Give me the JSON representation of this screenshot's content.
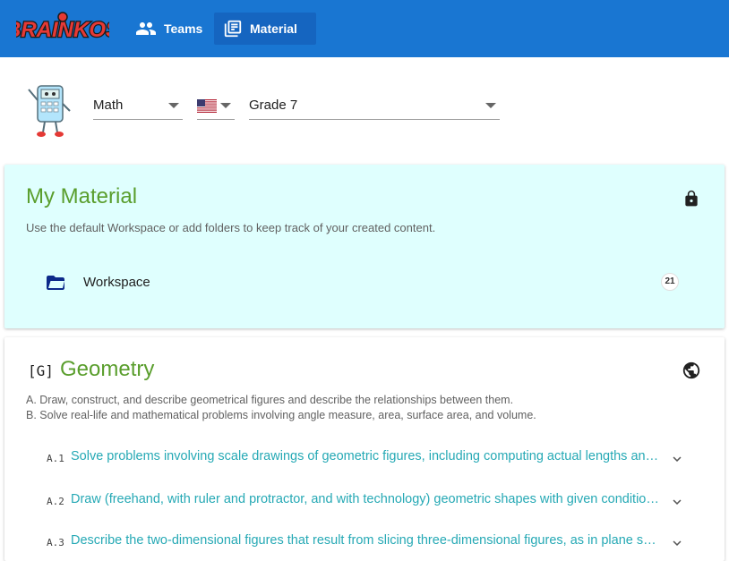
{
  "app": {
    "logo_text": "BRAINKOS",
    "nav": [
      {
        "label": "Teams",
        "icon": "people-icon"
      },
      {
        "label": "Material",
        "icon": "library-books-icon",
        "active": true
      }
    ],
    "colors": {
      "topbar": "#1976d2",
      "active_tab": "#1565c0",
      "title_green": "#5a9e2d",
      "link_teal": "#26a9b5"
    }
  },
  "selectors": {
    "subject": "Math",
    "language_flag": "us-flag-icon",
    "grade": "Grade 7"
  },
  "my_material": {
    "title": "My Material",
    "description": "Use the default Workspace or add folders to keep track of your created content.",
    "folder": {
      "label": "Workspace",
      "count": "21"
    }
  },
  "geometry": {
    "code": "[G]",
    "title": "Geometry",
    "description_lines": [
      "A. Draw, construct, and describe geometrical figures and describe the relationships between them.",
      "B. Solve real-life and mathematical problems involving angle measure, area, surface area, and volume."
    ],
    "standards": [
      {
        "code": "A.1",
        "text": "Solve problems involving scale drawings of geometric figures, including computing actual lengths and areas from a scale drawing and reproducing a scale drawing at a different scale."
      },
      {
        "code": "A.2",
        "text": "Draw (freehand, with ruler and protractor, and with technology) geometric shapes with given conditions. Focus on constructing triangles from three measures of angles or sides."
      },
      {
        "code": "A.3",
        "text": "Describe the two-dimensional figures that result from slicing three-dimensional figures, as in plane sections of right rectangular prisms and right rectangular pyramids."
      }
    ]
  }
}
